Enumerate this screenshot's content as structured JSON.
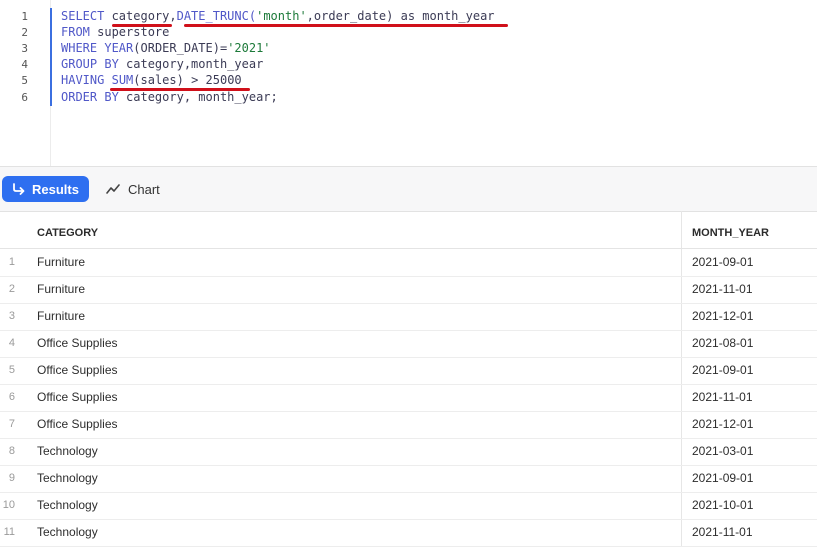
{
  "editor": {
    "line_numbers": [
      "1",
      "2",
      "3",
      "4",
      "5",
      "6"
    ],
    "code": [
      {
        "kw": "SELECT",
        "rest": " category,",
        "fn": "DATE_TRUNC(",
        "str": "'month'",
        "tail": ",order_date) as month_year"
      },
      {
        "kw": "FROM",
        "rest": " superstore"
      },
      {
        "kw": "WHERE",
        "rest": " ",
        "fn": "YEAR",
        "tail": "(ORDER_DATE)=",
        "str": "'2021'"
      },
      {
        "kw": "GROUP BY",
        "rest": " category,month_year"
      },
      {
        "kw": "HAVING",
        "rest": " ",
        "fn": "SUM",
        "tail": "(sales) > 25000"
      },
      {
        "kw": "ORDER BY",
        "rest": " category, month_year;"
      }
    ]
  },
  "tabs": {
    "results_label": "Results",
    "chart_label": "Chart"
  },
  "table": {
    "headers": [
      "CATEGORY",
      "MONTH_YEAR"
    ],
    "rows": [
      {
        "idx": "1",
        "category": "Furniture",
        "month_year": "2021-09-01"
      },
      {
        "idx": "2",
        "category": "Furniture",
        "month_year": "2021-11-01"
      },
      {
        "idx": "3",
        "category": "Furniture",
        "month_year": "2021-12-01"
      },
      {
        "idx": "4",
        "category": "Office Supplies",
        "month_year": "2021-08-01"
      },
      {
        "idx": "5",
        "category": "Office Supplies",
        "month_year": "2021-09-01"
      },
      {
        "idx": "6",
        "category": "Office Supplies",
        "month_year": "2021-11-01"
      },
      {
        "idx": "7",
        "category": "Office Supplies",
        "month_year": "2021-12-01"
      },
      {
        "idx": "8",
        "category": "Technology",
        "month_year": "2021-03-01"
      },
      {
        "idx": "9",
        "category": "Technology",
        "month_year": "2021-09-01"
      },
      {
        "idx": "10",
        "category": "Technology",
        "month_year": "2021-10-01"
      },
      {
        "idx": "11",
        "category": "Technology",
        "month_year": "2021-11-01"
      }
    ]
  },
  "colors": {
    "accent": "#2e6ff0",
    "keyword": "#5058c8",
    "string": "#1d7a3a",
    "annotation": "#d0101a"
  }
}
